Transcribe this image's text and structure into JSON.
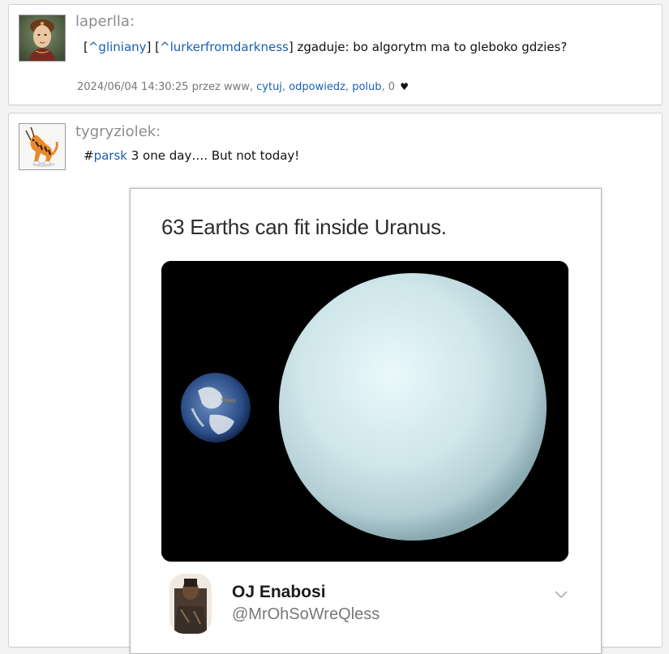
{
  "post1": {
    "username": "laperlla:",
    "mention1": "^gliniany",
    "mention2": "^lurkerfromdarkness",
    "text": " zgaduje: bo algorytm ma to gleboko gdzies?",
    "meta_prefix": "2024/06/04 14:30:25 przez www, ",
    "action_quote": "cytuj",
    "action_reply": "odpowiedz",
    "action_like": "polub",
    "like_count": "0"
  },
  "post2": {
    "username": "tygryziolek:",
    "hashtag": "parsk",
    "text": " 3 one day…. But not today!",
    "meme": {
      "title": "63 Earths can fit inside Uranus.",
      "tweet_name": "OJ Enabosi",
      "tweet_handle": "@MrOhSoWreQless"
    }
  },
  "colors": {
    "link": "#1a5fb4",
    "username": "#8c8c8c",
    "uranus": "#cfe6ea"
  },
  "icons": [
    "heart-icon",
    "chevron-down-icon"
  ]
}
